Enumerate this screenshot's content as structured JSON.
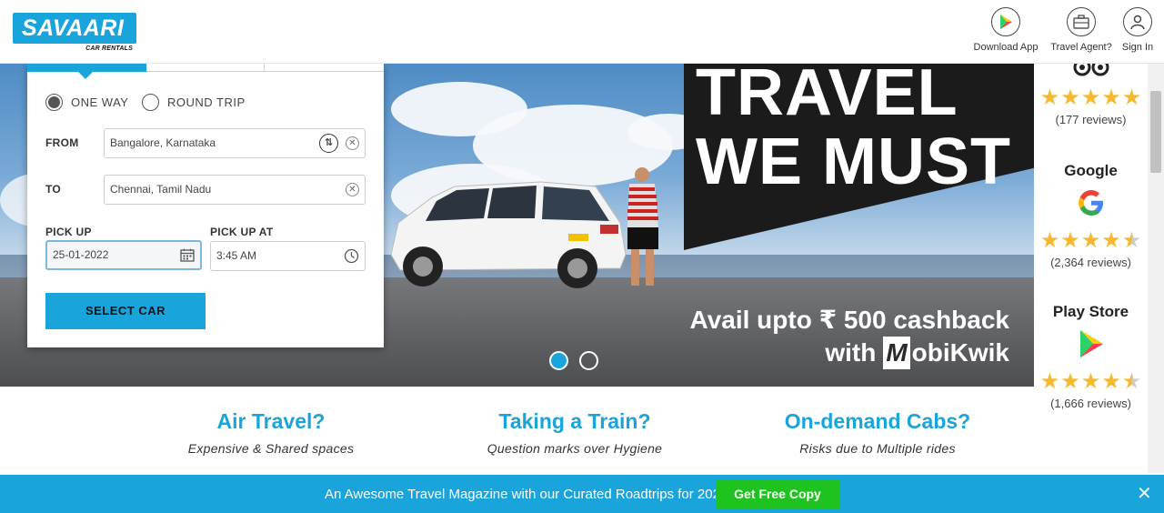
{
  "header": {
    "logo_text": "SAVAARI",
    "logo_sub": "CAR RENTALS",
    "nav": [
      {
        "label": "Download App",
        "icon": "play-store-icon"
      },
      {
        "label": "Travel Agent?",
        "icon": "briefcase-icon"
      },
      {
        "label": "Sign In",
        "icon": "user-icon"
      }
    ]
  },
  "booking": {
    "trip_types": [
      "ONE WAY",
      "ROUND TRIP"
    ],
    "selected_trip_type": "ONE WAY",
    "from_label": "FROM",
    "from_value": "Bangalore, Karnataka",
    "to_label": "TO",
    "to_value": "Chennai, Tamil Nadu",
    "pickup_label": "PICK UP",
    "pickup_date": "25-01-2022",
    "pickup_at_label": "PICK UP AT",
    "pickup_time": "3:45 AM",
    "select_car": "SELECT CAR"
  },
  "hero": {
    "headline_1": "TRAVEL",
    "headline_2": "WE MUST",
    "cashback_line": "Avail upto ₹ 500 cashback",
    "with_text": "with",
    "partner_m": "M",
    "partner_rest": "obiKwik",
    "slides": 2,
    "active_slide": 1
  },
  "reviews": [
    {
      "title": "",
      "icon": "tripadvisor-icon",
      "rating": 5,
      "count": "(177 reviews)"
    },
    {
      "title": "Google",
      "icon": "google-icon",
      "rating": 4.5,
      "count": "(2,364 reviews)"
    },
    {
      "title": "Play Store",
      "icon": "play-store-icon",
      "rating": 4.5,
      "count": "(1,666 reviews)"
    }
  ],
  "features": [
    {
      "title": "Air Travel?",
      "subtitle": "Expensive & Shared spaces"
    },
    {
      "title": "Taking a Train?",
      "subtitle": "Question marks over Hygiene"
    },
    {
      "title": "On-demand Cabs?",
      "subtitle": "Risks due to Multiple rides"
    }
  ],
  "banner": {
    "text": "An Awesome Travel Magazine with our Curated Roadtrips for 2022",
    "button": "Get Free Copy",
    "close": "✕"
  },
  "colors": {
    "brand": "#1aa4dc",
    "cta_green": "#1fc31f",
    "star": "#f5b82e"
  }
}
